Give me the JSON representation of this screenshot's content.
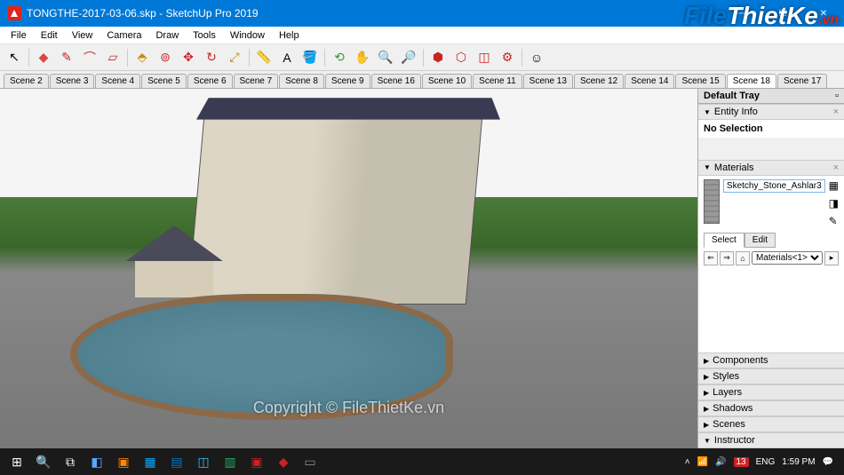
{
  "titlebar": {
    "title": "TONGTHE-2017-03-06.skp - SketchUp Pro 2019"
  },
  "menu": [
    "File",
    "Edit",
    "View",
    "Camera",
    "Draw",
    "Tools",
    "Window",
    "Help"
  ],
  "scenes": [
    "Scene 2",
    "Scene 3",
    "Scene 4",
    "Scene 5",
    "Scene 6",
    "Scene 7",
    "Scene 8",
    "Scene 9",
    "Scene 16",
    "Scene 10",
    "Scene 11",
    "Scene 13",
    "Scene 12",
    "Scene 14",
    "Scene 15",
    "Scene 18",
    "Scene 17"
  ],
  "active_scene": "Scene 18",
  "tray": {
    "title": "Default Tray",
    "entity_info": {
      "label": "Entity Info",
      "content": "No Selection"
    },
    "materials": {
      "label": "Materials",
      "current_name": "Sketchy_Stone_Ashlar3",
      "tabs": [
        "Select",
        "Edit"
      ],
      "active_tab": "Select",
      "library": "Materials<1>"
    },
    "collapsed": [
      "Components",
      "Styles",
      "Layers",
      "Shadows",
      "Scenes",
      "Instructor"
    ]
  },
  "watermark": "Copyright © FileThietKe.vn",
  "logo": {
    "text1": "File",
    "text2": "ThietKe",
    "suffix": ".vn"
  },
  "taskbar": {
    "lang": "ENG",
    "time": "1:59 PM",
    "notif_count": "13"
  }
}
